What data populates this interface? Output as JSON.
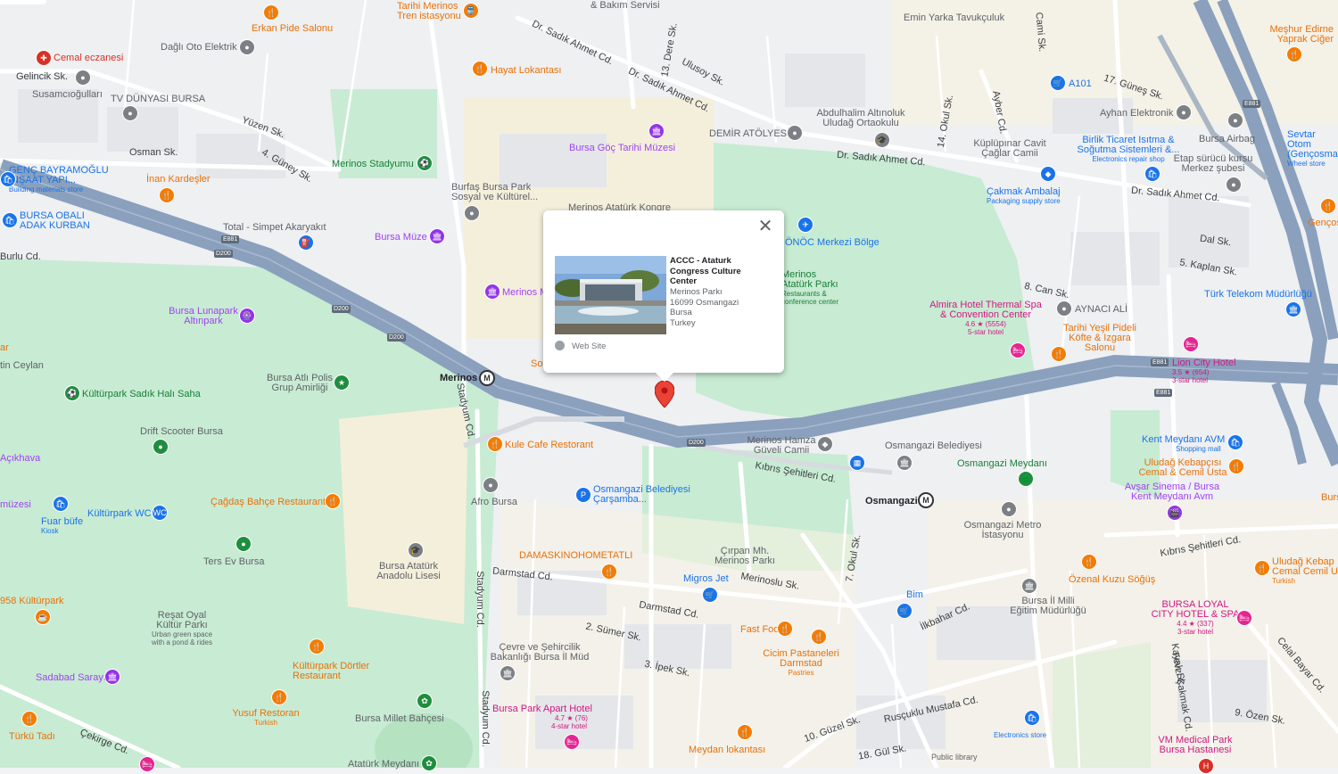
{
  "popup": {
    "title": "ACCC - Ataturk Congress Culture Center",
    "address": [
      "Merinos Parkı",
      "16099 Osmangazi",
      "Bursa",
      "Turkey"
    ],
    "website_label": "Web Site"
  },
  "streets": [
    "Dr. Sadık Ahmet Cd.",
    "Dr. Sadık Ahmet Cd.",
    "Dr. Sadık Ahmet Cd.",
    "Dr. Sadık Ahmet Cd.",
    "Burlu Cd.",
    "Kıbrıs Şehitleri Cd.",
    "Kıbrıs Şehitleri Cd.",
    "Darmstad Cd.",
    "Darmstad Cd.",
    "Stadyum Cd.",
    "Stadyum Cd.",
    "Stadyum Cd.",
    "Merinoslu Sk.",
    "Rusçuklu Mustafa Cd.",
    "Osman Sk.",
    "Yüzen Sk.",
    "4. Güney Sk.",
    "17. Güneş Sk.",
    "Dal Sk.",
    "5. Kaplan Sk.",
    "8. Can Sk.",
    "Ulusoy Sk.",
    "İlkbahar Cd.",
    "10. Güzel Sk.",
    "18. Gül Sk.",
    "2. Sümer Sk.",
    "3. İpek Sk.",
    "9. Özen Sk.",
    "Çekirge Cd.",
    "Gelincik Sk.",
    "Ayber Cd.",
    "Cami Sk.",
    "14. Okul Sk.",
    "7. Okul Sk.",
    "Kayalı Sk.",
    "Fevzi Çakmak Cd.",
    "Celal Bayar Cd."
  ],
  "road_shields": [
    "E881",
    "D200",
    "D200",
    "D200",
    "D200",
    "E881",
    "E881",
    "E881"
  ],
  "places": {
    "cemal_eczanesi": "Cemal eczanesi",
    "dagli_oto": "Dağlı Oto Elektrik",
    "erkan_pide": "Erkan Pide Salonu",
    "tarihi_merinos_tren": "Tarihi Merinos Tren istasyonu",
    "bakim_servisi": "& Bakım Servisi",
    "emin_yarka": "Emin Yarka Tavukçuluk",
    "mesur_firin": "Meşhur Edirne Yaprak Ciğer",
    "hayat_lokantasi": "Hayat Lokantası",
    "susamcioglu": "Susamcıoğulları",
    "tv_dunyasi": "TV DÜNYASI BURSA",
    "a101": "A101",
    "ayhan_elektronik": "Ayhan Elektronik",
    "bursa_airbag": "Bursa Airbag",
    "sevtar": "Sevtar Otom (Gençosma",
    "sevtar_sub": "Wheel store",
    "abdulhalim": "Abdulhalim Altınoluk Uludağ Ortaokulu",
    "demir_atolyesi": "DEMİR ATÖLYESİ",
    "bursa_goc": "Bursa Göç Tarihi Müzesi",
    "kuplupinar": "Küplüpınar Cavit Çağlar Camii",
    "birlik_ticaret": "Birlik Ticaret Isıtma & Soğutma Sistemleri &...",
    "birlik_sub": "Electronics repair shop",
    "etap_surucu": "Etap sürücü kursu Merkez şubesi",
    "genc_bayramoglu": "GENÇ BAYRAMOĞLU İNŞAAT YAPI...",
    "genc_sub": "Building materials store",
    "inan_kardesler": "İnan Kardeşler",
    "merinos_stadyumu": "Merinos Stadyumu",
    "burfas": "Burfaş Bursa Park Sosyal ve Kültürel...",
    "merinos_kongre": "Merinos Atatürk Kongre",
    "cakmak_ambalaj": "Çakmak Ambalaj",
    "cakmak_sub": "Packaging supply store",
    "gencosman": "Gençosm",
    "bursa_obali": "BURSA OBALI ADAK KURBAN",
    "total": "Total - Simpet Akaryakıt",
    "bursa_muze": "Bursa Müze",
    "onoc": "ÖNÖC Merkezi Bölge",
    "merinos_parki": "Merinos Atatürk Parkı",
    "merinos_parki_sub": "Restaurants & conference center",
    "merinos_m": "Merinos M",
    "telekom": "Türk Telekom Müdürlüğü",
    "almira": "Almira Hotel Thermal Spa & Convention Center",
    "almira_rating": "4.6 ★ (5554)",
    "almira_sub": "5-star hotel",
    "aynaci_ali": "AYNACI ALİ",
    "tarihi_yesil": "Tarihi Yeşil Pideli Köfte & Izgara Salonu",
    "bursa_lunapark": "Bursa Lunapark Altınpark",
    "lion_city": "Lion City Hotel",
    "lion_rating": "3.5 ★ (654)",
    "lion_sub": "3-star hotel",
    "atli_polis": "Bursa Atlı Polis Grup Amirliği",
    "merinos_station": "Merinos",
    "kulturpark_hali": "Kültürpark Sadık Halı Saha",
    "tin_ceylan": "tin Ceylan",
    "ar": "ar",
    "so": "So",
    "drift": "Drift Scooter Bursa",
    "kule_cafe": "Kule Cafe Restorant",
    "merinos_hamza": "Merinos Hamza Güveli Camii",
    "osmangazi_belediyesi": "Osmangazi Belediyesi",
    "osmangazi_meydani": "Osmangazi Meydanı",
    "kent_meydani_avm": "Kent Meydanı AVM",
    "kent_sub": "Shopping mall",
    "uludag_kebapci": "Uludağ Kebapçısı Cemal & Cemil Usta",
    "avsar": "Avşar Sinema / Bursa Kent Meydanı Avm",
    "burs": "Burs",
    "acikhava": "Açıkhava",
    "afro_bursa": "Afro Bursa",
    "osmangazi_carsamba": "Osmangazi Belediyesi Çarşamba...",
    "osmangazi_station": "Osmangazi",
    "osmangazi_metro": "Osmangazi Metro İstasyonu",
    "muzesi": "müzesi",
    "fuar_bufe": "Fuar büfe",
    "fuar_sub": "Kiosk",
    "kulturpark_wc": "Kültürpark WC",
    "cagdas_bahce": "Çağdaş Bahçe Restaurant",
    "ters_ev": "Ters Ev Bursa",
    "bursa_ataturk_lisesi": "Bursa Atatürk Anadolu Lisesi",
    "damaskino": "DAMASKINOHOMETATLI",
    "cirpan": "Çırpan Mh. Merinos Parkı",
    "migros": "Migros Jet",
    "bim": "Bim",
    "ozenal": "Özenal Kuzu Söğüş",
    "bursa_il_milli": "Bursa İl Milli Eğitim Müdürlüğü",
    "uludag_kebap2": "Uludağ Kebap Cemal Cemil U",
    "uludag_kebap2_sub": "Turkish",
    "kulturpark_958": "958 Kültürpark",
    "resat_oyal": "Reşat Oyal Kültür Parkı",
    "resat_sub": "Urban green space with a pond & rides",
    "fast_food": "Fast Food",
    "cicim": "Cicim Pastaneleri Darmstad",
    "cicim_sub": "Pastries",
    "bursa_loyal": "BURSA LOYAL CITY HOTEL & SPA",
    "loyal_rating": "4.4 ★ (337)",
    "loyal_sub": "3-star hotel",
    "sadabad": "Sadabad Sarayı",
    "kulturpark_dortler": "Kültürpark Dörtler Restaurant",
    "cevre": "Çevre ve Şehircilik Bakanlığı Bursa İl Müd",
    "yusuf": "Yusuf Restoran",
    "yusuf_sub": "Turkish",
    "bursa_millet": "Bursa Millet Bahçesi",
    "bursa_park_apart": "Bursa Park Apart Hotel",
    "apart_rating": "4.7 ★ (76)",
    "apart_sub": "4-star hotel",
    "turku_tadi": "Türkü Tadı",
    "electronics_store": "Electronics store",
    "vm_medical": "VM Medical Park Bursa Hastanesi",
    "meydan_lokantasi": "Meydan lokantası",
    "ataturk_meydani": "Atatürk Meydanı",
    "public_library": "Public library",
    "dere_sk": "13. Dere Sk."
  }
}
